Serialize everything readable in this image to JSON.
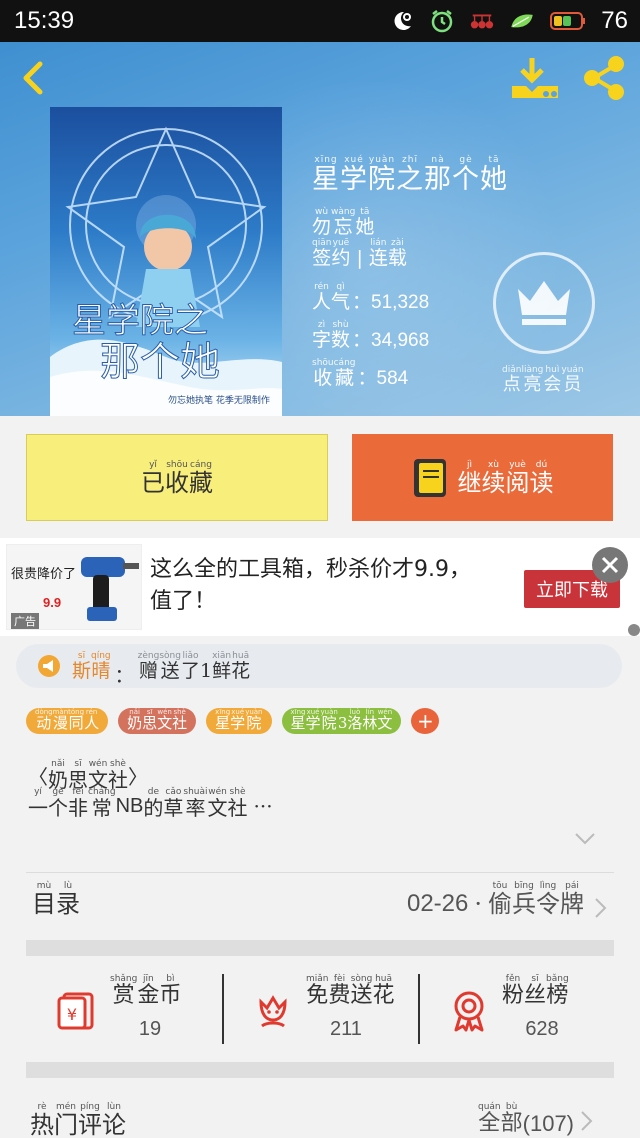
{
  "status_bar": {
    "time": "15:39",
    "battery": "76"
  },
  "colors": {
    "accent": "#ea6a3a",
    "collected_bg": "#f8ee7c",
    "hero": "#5ba3dc",
    "user": "#e6872c"
  },
  "book": {
    "title": [
      [
        "xīng",
        "星"
      ],
      [
        "xué",
        "学"
      ],
      [
        "yuàn",
        "院"
      ],
      [
        "zhī",
        "之"
      ],
      [
        "nà",
        "那"
      ],
      [
        "gè",
        "个"
      ],
      [
        "tā",
        "她"
      ]
    ],
    "author": [
      [
        "wù",
        "勿"
      ],
      [
        "wàng",
        "忘"
      ],
      [
        "tā",
        "她"
      ]
    ],
    "status": {
      "signed": [
        [
          "qiān",
          "签"
        ],
        [
          "yuē",
          "约"
        ]
      ],
      "sep": "|",
      "serial": [
        [
          "lián",
          "连"
        ],
        [
          "zài",
          "载"
        ]
      ]
    },
    "popularity": {
      "label": [
        [
          "rén",
          "人"
        ],
        [
          "qì",
          "气"
        ]
      ],
      "value": "51,328"
    },
    "words": {
      "label": [
        [
          "zì",
          "字"
        ],
        [
          "shù",
          "数"
        ]
      ],
      "value": "34,968"
    },
    "favorites": {
      "label": [
        [
          "shōu",
          "收"
        ],
        [
          "cáng",
          "藏"
        ]
      ],
      "value": "584"
    },
    "cover_text": {
      "line1": "星学院之",
      "line2": "那个她",
      "small": "勿忘她执笔 花季无限制作"
    }
  },
  "vip": {
    "label": [
      [
        "diǎn",
        "点"
      ],
      [
        "liàng",
        "亮"
      ],
      [
        "huì",
        "会"
      ],
      [
        "yuán",
        "员"
      ]
    ]
  },
  "actions": {
    "collected": [
      [
        "yǐ",
        "已"
      ],
      [
        "shōu",
        "收"
      ],
      [
        "cáng",
        "藏"
      ]
    ],
    "continue": [
      [
        "jì",
        "继"
      ],
      [
        "xù",
        "续"
      ],
      [
        "yuè",
        "阅"
      ],
      [
        "dú",
        "读"
      ]
    ]
  },
  "ad": {
    "thumb_headline": "很贵降价了",
    "thumb_price": "9.9",
    "thumb_tag": "广告",
    "text": "这么全的工具箱，秒杀价才9.9，值了！",
    "cta": "立即下载"
  },
  "gift": {
    "user": [
      [
        "sī",
        "斯"
      ],
      [
        "qíng",
        "晴"
      ]
    ],
    "colon": "：",
    "action": [
      [
        "zèng",
        "赠"
      ],
      [
        "sòng",
        "送"
      ],
      [
        "liǎo",
        "了"
      ],
      [
        "",
        "1"
      ],
      [
        "xiān",
        "鲜"
      ],
      [
        "huā",
        "花"
      ]
    ]
  },
  "tags": [
    {
      "chars": [
        [
          "dòng",
          "动"
        ],
        [
          "màn",
          "漫"
        ],
        [
          "tóng",
          "同"
        ],
        [
          "rén",
          "人"
        ]
      ],
      "color": "#f1a93a"
    },
    {
      "chars": [
        [
          "nǎi",
          "奶"
        ],
        [
          "sī",
          "思"
        ],
        [
          "wén",
          "文"
        ],
        [
          "shè",
          "社"
        ]
      ],
      "color": "#d4735d"
    },
    {
      "chars": [
        [
          "xīng",
          "星"
        ],
        [
          "xué",
          "学"
        ],
        [
          "yuàn",
          "院"
        ]
      ],
      "color": "#f1a93a"
    },
    {
      "chars": [
        [
          "xīng",
          "星"
        ],
        [
          "xué",
          "学"
        ],
        [
          "yuàn",
          "院"
        ],
        [
          "",
          "3"
        ],
        [
          "luò",
          "洛"
        ],
        [
          "lín",
          "林"
        ],
        [
          "wén",
          "文"
        ]
      ],
      "color": "#8cbf3f"
    }
  ],
  "tag_add": "+",
  "intro": {
    "title_open": "〈",
    "title": [
      [
        "nǎi",
        "奶"
      ],
      [
        "sī",
        "思"
      ],
      [
        "wén",
        "文"
      ],
      [
        "shè",
        "社"
      ]
    ],
    "title_close": "〉",
    "text_a": [
      [
        "yí",
        "一"
      ],
      [
        "gè",
        "个"
      ],
      [
        "fēi",
        "非"
      ],
      [
        "cháng",
        "常"
      ]
    ],
    "text_latin": "NB",
    "text_b": [
      [
        "de",
        "的"
      ],
      [
        "cǎo",
        "草"
      ],
      [
        "shuài",
        "率"
      ],
      [
        "wén",
        "文"
      ],
      [
        "shè",
        "社"
      ]
    ],
    "ellipsis": "···"
  },
  "catalog": {
    "label": [
      [
        "mù",
        "目"
      ],
      [
        "lù",
        "录"
      ]
    ],
    "date": "02-26",
    "dot": "·",
    "latest": [
      [
        "tōu",
        "偷"
      ],
      [
        "bīng",
        "兵"
      ],
      [
        "lìng",
        "令"
      ],
      [
        "pái",
        "牌"
      ]
    ]
  },
  "stats": [
    {
      "name": [
        [
          "shǎng",
          "赏"
        ],
        [
          "jīn",
          "金"
        ],
        [
          "bì",
          "币"
        ]
      ],
      "value": "19",
      "icon": "red-envelope-icon"
    },
    {
      "name": [
        [
          "miǎn",
          "免"
        ],
        [
          "fèi",
          "费"
        ],
        [
          "sòng",
          "送"
        ],
        [
          "huā",
          "花"
        ]
      ],
      "value": "211",
      "icon": "flower-icon"
    },
    {
      "name": [
        [
          "fěn",
          "粉"
        ],
        [
          "sī",
          "丝"
        ],
        [
          "bǎng",
          "榜"
        ]
      ],
      "value": "628",
      "icon": "medal-icon"
    }
  ],
  "comments": {
    "label": [
      [
        "rè",
        "热"
      ],
      [
        "mén",
        "门"
      ],
      [
        "píng",
        "评"
      ],
      [
        "lùn",
        "论"
      ]
    ],
    "all": [
      [
        "quán",
        "全"
      ],
      [
        "bù",
        "部"
      ]
    ],
    "count": "(107)"
  }
}
